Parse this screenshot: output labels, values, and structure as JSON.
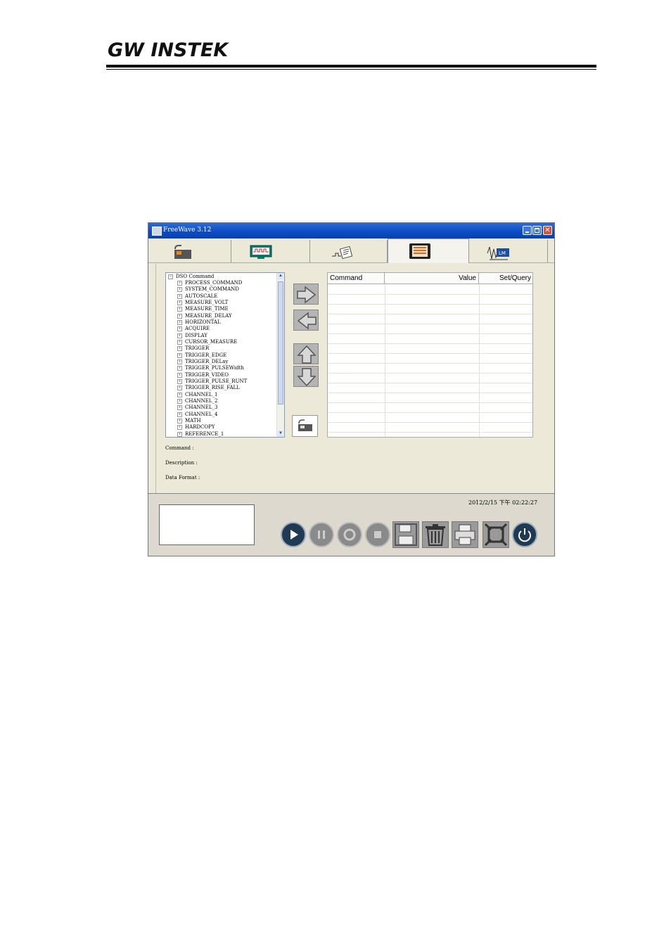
{
  "header": {
    "brand": "GW INSTEK"
  },
  "window": {
    "title": "FreeWave 3.12",
    "close_glyph": "✕"
  },
  "tabs": [
    {
      "icon": "connection-icon"
    },
    {
      "icon": "waveform-monitor-icon"
    },
    {
      "icon": "waveform-edit-icon"
    },
    {
      "icon": "command-list-icon",
      "active": true
    },
    {
      "icon": "data-log-icon"
    }
  ],
  "tree": {
    "root": "DSO Command",
    "root_toggle": "−",
    "item_toggle": "+",
    "items": [
      "PROCESS_COMMAND",
      "SYSTEM_COMMAND",
      "AUTOSCALE",
      "MEASURE_VOLT",
      "MEASURE_TIME",
      "MEASURE_DELAY",
      "HORIZONTAL",
      "ACQUIRE",
      "DISPLAY",
      "CURSOR_MEASURE",
      "TRIGGER",
      "TRIGGER_EDGE",
      "TRIGGER_DELay",
      "TRIGGER_PULSEWidth",
      "TRIGGER_VIDEO",
      "TRIGGER_PULSE_RUNT",
      "TRIGGER_RISE_FALL",
      "CHANNEL_1",
      "CHANNEL_2",
      "CHANNEL_3",
      "CHANNEL_4",
      "MATH",
      "HARDCOPY",
      "REFERENCE_1"
    ]
  },
  "table": {
    "columns": [
      "Command",
      "Value",
      "Set/Query"
    ]
  },
  "info": {
    "command_label": "Command :",
    "description_label": "Description :",
    "data_format_label": "Data Format :"
  },
  "status": {
    "timestamp": "2012/2/15 下午 02:22:27"
  },
  "toolbar": [
    "play-icon",
    "pause-icon",
    "record-icon",
    "stop-icon",
    "save-icon",
    "trash-icon",
    "print-icon",
    "fullscreen-icon",
    "power-icon"
  ],
  "colors": {
    "titlebar": "#0a4ac4",
    "panel": "#ece9d8",
    "button_dark": "#1f3a52",
    "button_gray": "#8a8a8a"
  }
}
